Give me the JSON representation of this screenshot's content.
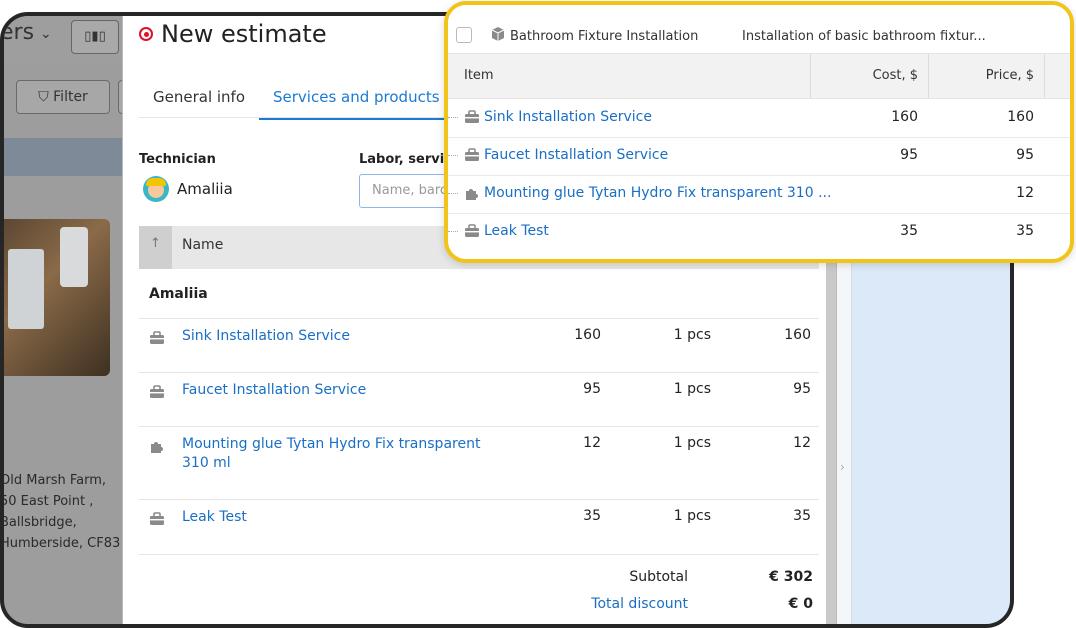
{
  "background": {
    "title_fragment": "ers",
    "filter_label": "Filter",
    "address": "Old Marsh Farm, 50 East Point , Ballsbridge, Humberside, CF83"
  },
  "panel": {
    "title": "New estimate",
    "tabs": [
      {
        "label": "General info",
        "active": false
      },
      {
        "label": "Services and products",
        "active": true
      }
    ],
    "technician_label": "Technician",
    "technician_name": "Amaliia",
    "labor_label": "Labor, service",
    "labor_placeholder": "Name, barcode",
    "table": {
      "name_header": "Name",
      "group": "Amaliia",
      "rows": [
        {
          "icon": "toolbox-icon",
          "name": "Sink Installation Service",
          "price": "160",
          "qty": "1 pcs",
          "total": "160"
        },
        {
          "icon": "toolbox-icon",
          "name": "Faucet Installation Service",
          "price": "95",
          "qty": "1 pcs",
          "total": "95"
        },
        {
          "icon": "puzzle-icon",
          "name": "Mounting glue Tytan Hydro Fix transparent 310 ml",
          "price": "12",
          "qty": "1 pcs",
          "total": "12"
        },
        {
          "icon": "toolbox-icon",
          "name": "Leak Test",
          "price": "35",
          "qty": "1 pcs",
          "total": "35"
        }
      ]
    },
    "subtotal_label": "Subtotal",
    "subtotal_value": "€ 302",
    "discount_label": "Total discount",
    "discount_value": "€ 0"
  },
  "popup": {
    "kit_name": "Bathroom Fixture Installation",
    "kit_description": "Installation of basic bathroom fixtur...",
    "headers": {
      "item": "Item",
      "cost": "Cost, $",
      "price": "Price, $"
    },
    "rows": [
      {
        "icon": "toolbox-icon",
        "name": "Sink Installation Service",
        "cost": "160",
        "price": "160"
      },
      {
        "icon": "toolbox-icon",
        "name": "Faucet Installation Service",
        "cost": "95",
        "price": "95"
      },
      {
        "icon": "puzzle-icon",
        "name": "Mounting glue Tytan Hydro Fix transparent 310 ...",
        "cost": "",
        "price": "12"
      },
      {
        "icon": "toolbox-icon",
        "name": "Leak Test",
        "cost": "35",
        "price": "35"
      }
    ]
  },
  "colors": {
    "accent": "#1a7ad4",
    "highlight": "#f0c418",
    "record": "#e0102a"
  }
}
